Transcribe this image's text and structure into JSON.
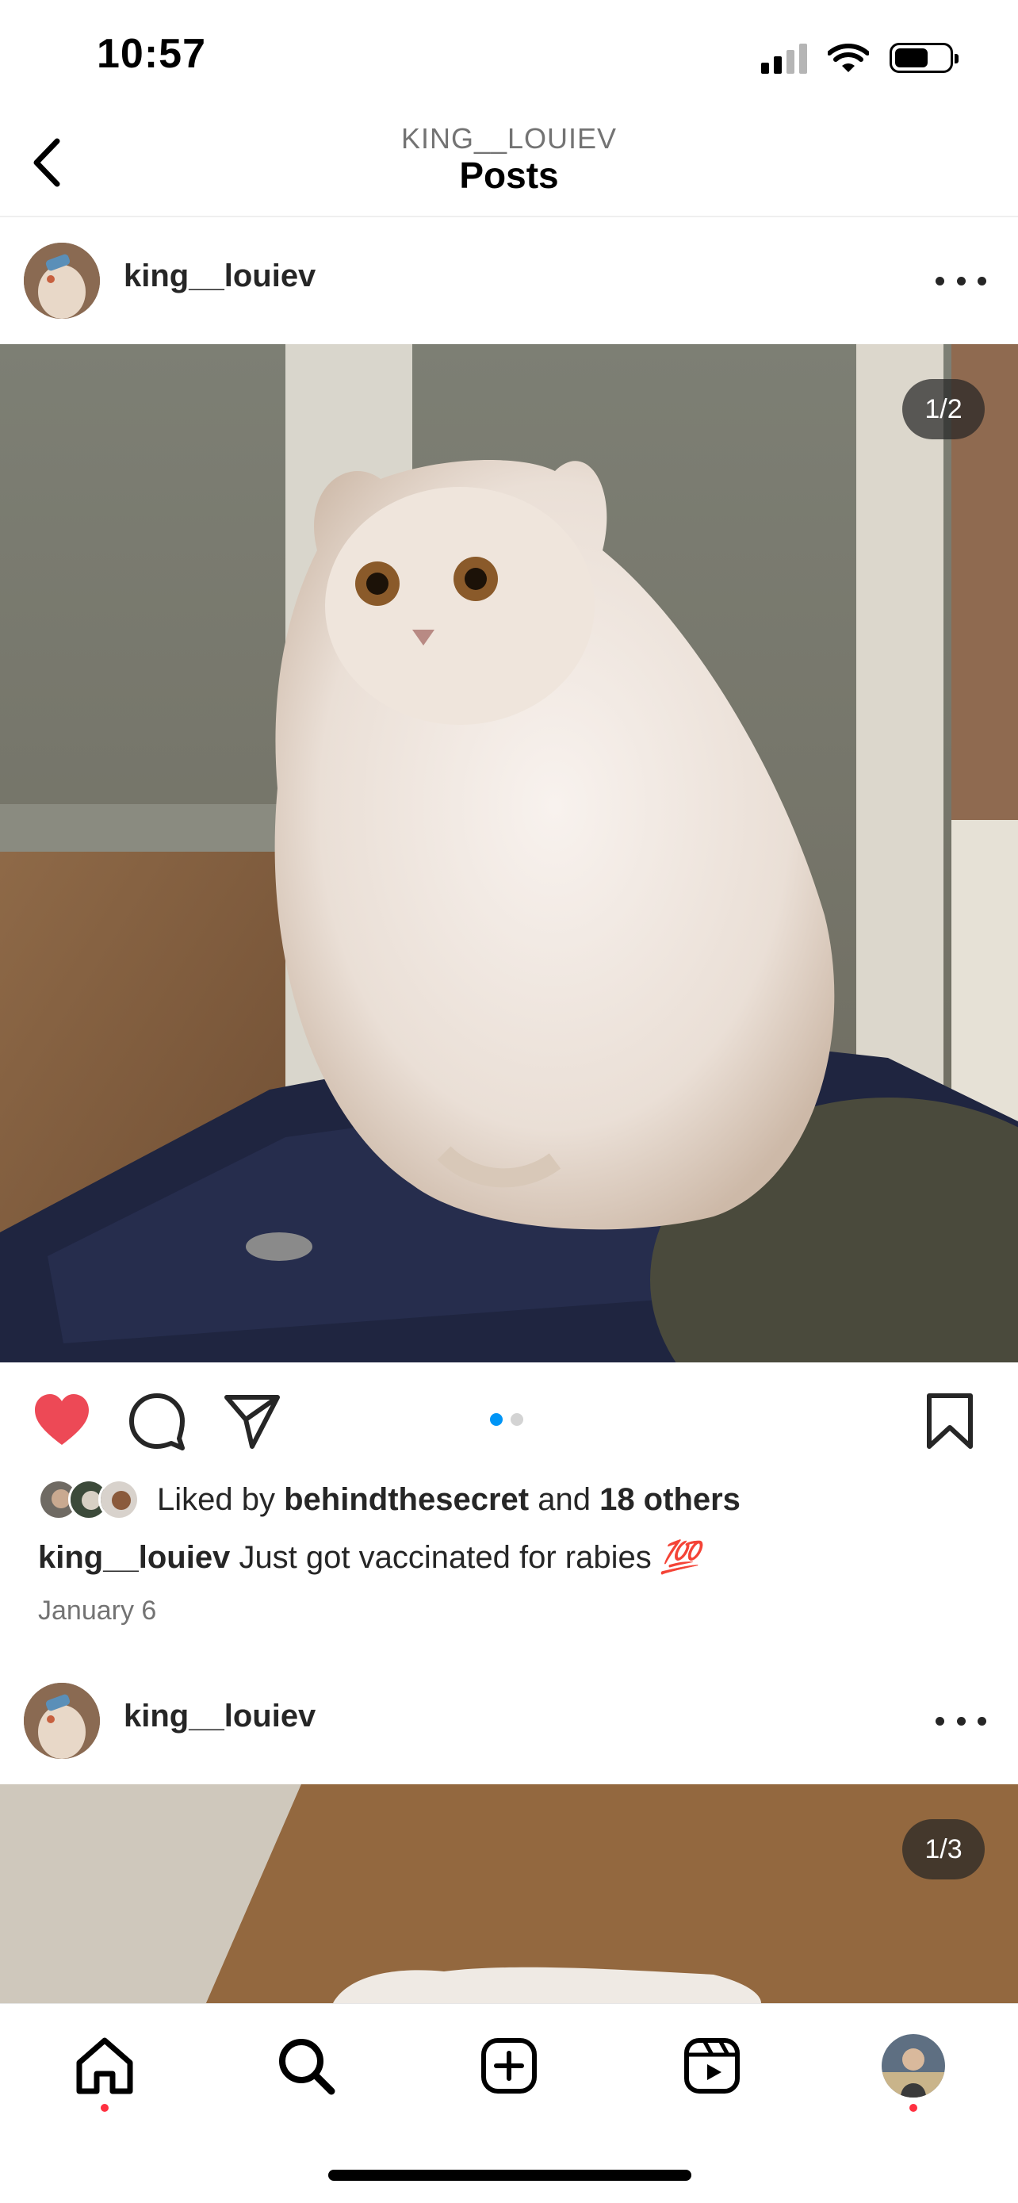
{
  "status_bar": {
    "time": "10:57",
    "battery_level": 0.62
  },
  "header": {
    "account": "KING__LOUIEV",
    "title": "Posts",
    "back_icon": "chevron-left-icon"
  },
  "posts": [
    {
      "username": "king__louiev",
      "photo_counter": "1/2",
      "carousel_active_index": 0,
      "carousel_count": 2,
      "liked": true,
      "likes": {
        "prefix": "Liked by",
        "liked_by": "behindthesecret",
        "joiner": "and",
        "others": "18 others"
      },
      "caption": {
        "username": "king__louiev",
        "text": "Just got vaccinated for rabies",
        "emoji": "💯"
      },
      "date": "January 6"
    },
    {
      "username": "king__louiev",
      "photo_counter": "1/3"
    }
  ],
  "tab_bar": {
    "items": [
      "home-icon",
      "search-icon",
      "new-post-icon",
      "reels-icon",
      "profile-avatar"
    ],
    "active": "home-icon",
    "notification_dots": [
      "home-icon",
      "profile-avatar"
    ]
  },
  "colors": {
    "like_red": "#ed4956",
    "carousel_blue": "#0095f6",
    "notification_red": "#ff3040"
  }
}
